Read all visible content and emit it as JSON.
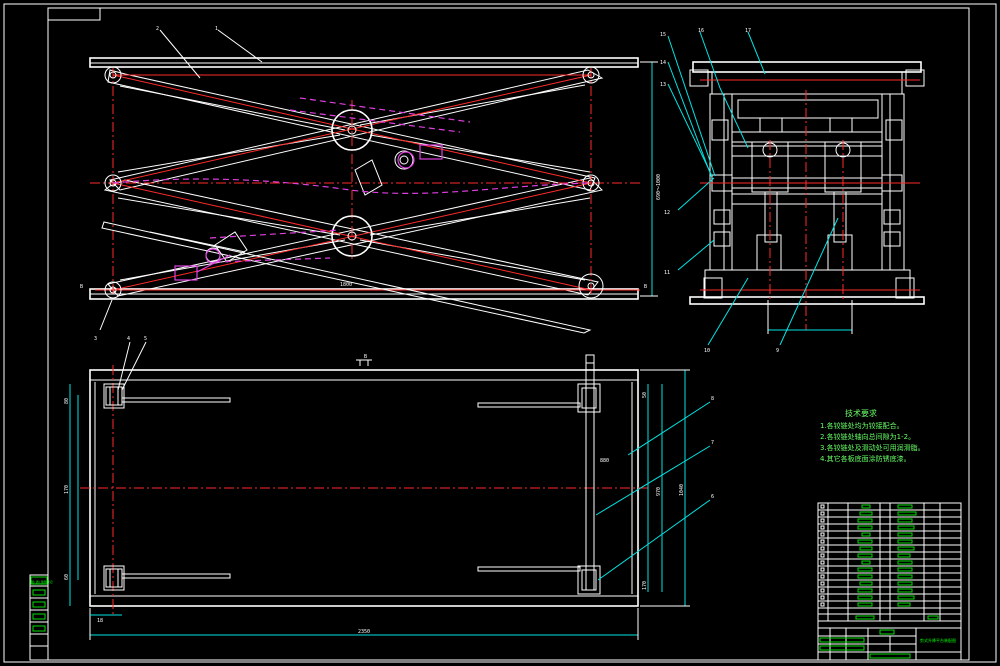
{
  "sheet": {
    "background": "#000000",
    "line_color": "#ffffff",
    "center_line_color": "#ff2a2a",
    "phantom_color": "#e040e0",
    "leader_color": "#00e5e5",
    "table_color": "#00dd00"
  },
  "part_labels": {
    "p1": "1",
    "p2": "2",
    "p3": "3",
    "p4": "4",
    "p5": "5",
    "p6": "6",
    "p7": "7",
    "p8": "8",
    "p9": "9",
    "p10": "10",
    "p11": "11",
    "p12": "12",
    "p13": "13",
    "p14": "14",
    "p15": "15",
    "p16": "16",
    "p17": "17"
  },
  "section_marks": {
    "b_left": "B",
    "b_right": "B",
    "view_b": "B"
  },
  "dimensions": {
    "height_vertical": "690～1000",
    "base_width": "1800",
    "total_length": "2350",
    "plan_width": "1040",
    "plan_depth": "970",
    "small_a": "80",
    "small_b": "60",
    "small_c": "170",
    "small_d": "170",
    "small_e": "18",
    "small_f": "880",
    "small_g": "50"
  },
  "requirements": {
    "title": "技术要求",
    "items": [
      "1.各铰链处均为铰接配合。",
      "2.各铰链处轴向总间隙为1-2。",
      "3.各铰链处及滑动处可用润滑脂。",
      "4.其它各板底面涂防锈底漆。"
    ]
  },
  "title_block": {
    "drawing_name": "剪式升降平台装配图",
    "scale_label": "比例"
  },
  "side_stamp": {
    "label": "借(通)用件登记"
  }
}
